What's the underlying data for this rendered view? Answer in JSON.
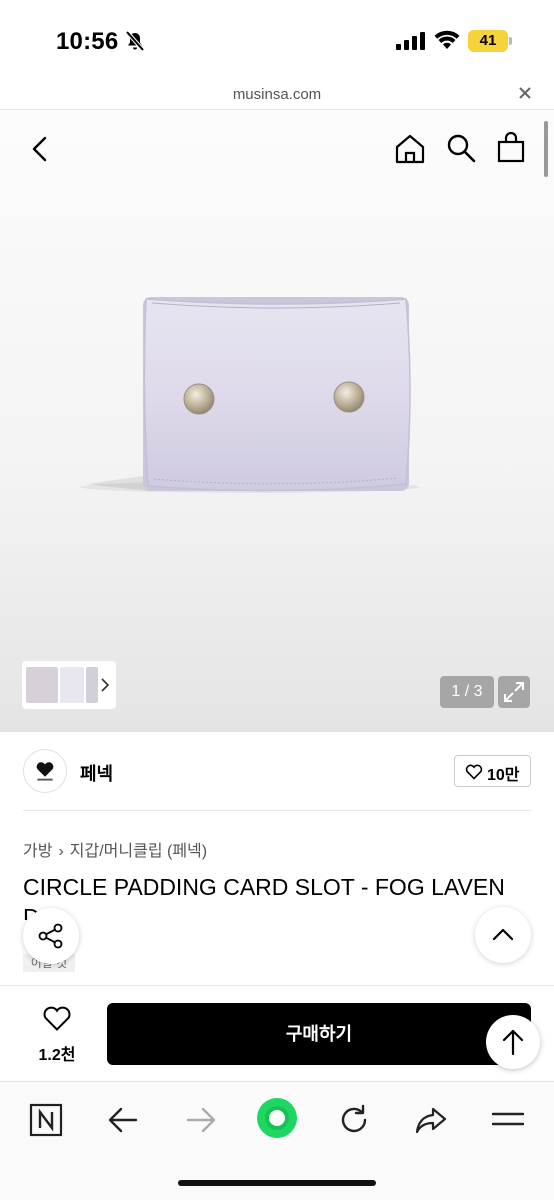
{
  "status_bar": {
    "time": "10:56",
    "battery": "41"
  },
  "browser": {
    "url": "musinsa.com"
  },
  "gallery": {
    "pager": "1 / 3"
  },
  "brand": {
    "name": "페넥",
    "likes": "10만"
  },
  "breadcrumb": {
    "category": "가방",
    "subcategory": "지갑/머니클립 (페넥)"
  },
  "product": {
    "title": "CIRCLE PADDING CARD SLOT - FOG LAVEN",
    "title_wrap": "D",
    "chip": "이달 컷"
  },
  "purchase": {
    "wish_count": "1.2천",
    "buy_label": "구매하기"
  },
  "colors": {
    "wallet": "#dcd8ea",
    "accent_green": "#1ed760",
    "buy_button": "#000000"
  }
}
